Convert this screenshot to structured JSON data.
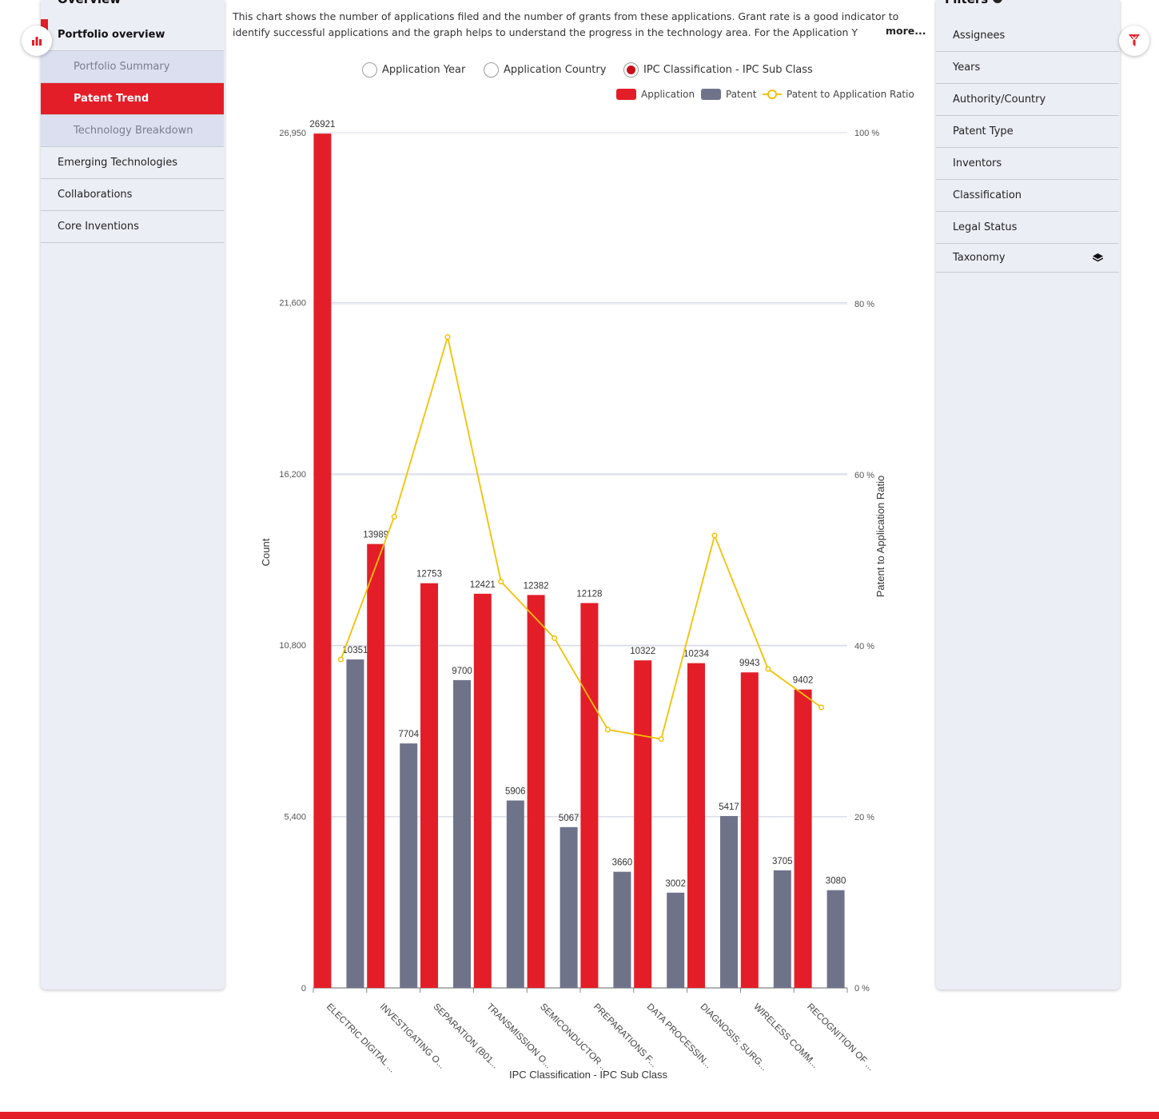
{
  "left_panel": {
    "title": "Overview",
    "items": [
      {
        "label": "Portfolio overview"
      },
      {
        "label": "Portfolio Summary"
      },
      {
        "label": "Patent Trend"
      },
      {
        "label": "Technology Breakdown"
      },
      {
        "label": "Emerging Technologies"
      },
      {
        "label": "Collaborations"
      },
      {
        "label": "Core Inventions"
      }
    ]
  },
  "right_panel": {
    "title": "Filters",
    "items": [
      {
        "label": "Assignees"
      },
      {
        "label": "Years"
      },
      {
        "label": "Authority/Country"
      },
      {
        "label": "Patent Type"
      },
      {
        "label": "Inventors"
      },
      {
        "label": "Classification"
      },
      {
        "label": "Legal Status"
      },
      {
        "label": "Taxonomy"
      }
    ]
  },
  "description": {
    "text": "This chart shows the number of applications filed and the number of grants from these applications. Grant rate is a good indicator to identify successful applications and the graph helps to understand the progress in the technology area. For the Application Y",
    "more": "more..."
  },
  "radios": {
    "options": [
      "Application Year",
      "Application Country",
      "IPC Classification - IPC Sub Class"
    ],
    "selected": "IPC Classification - IPC Sub Class"
  },
  "colors": {
    "application": "#e31e28",
    "patent": "#6f738a",
    "ratio": "#f5c000"
  },
  "chart_data": {
    "type": "bar",
    "legend": [
      "Application",
      "Patent",
      "Patent to Application Ratio"
    ],
    "xlabel": "IPC Classification - IPC Sub Class",
    "ylabel": "Count",
    "y2label": "Patent to Application Ratio",
    "ylim": [
      0,
      26950
    ],
    "y_ticks": [
      "0",
      "5,400",
      "10,800",
      "16,200",
      "21,600",
      "26,950"
    ],
    "y2lim": [
      0,
      100
    ],
    "y2_ticks": [
      "0 %",
      "20 %",
      "40 %",
      "60 %",
      "80 %",
      "100 %"
    ],
    "categories": [
      "ELECTRIC DIGITAL ...",
      "INVESTIGATING O...",
      "SEPARATION (B01...",
      "TRANSMISSION O...",
      "SEMICONDUCTOR ...",
      "PREPARATIONS F...",
      "DATA PROCESSIN...",
      "DIAGNOSIS; SURG...",
      "WIRELESS COMM...",
      "RECOGNITION OF ..."
    ],
    "series": [
      {
        "name": "Application",
        "values": [
          26921,
          13989,
          12753,
          12421,
          12382,
          12128,
          10322,
          10234,
          9943,
          9402
        ]
      },
      {
        "name": "Patent",
        "values": [
          10351,
          7704,
          9700,
          5906,
          5067,
          3660,
          3002,
          5417,
          3705,
          3080
        ]
      },
      {
        "name": "Patent to Application Ratio",
        "values": [
          38.4,
          55.1,
          76.1,
          47.5,
          40.9,
          30.2,
          29.1,
          52.9,
          37.3,
          32.8
        ]
      }
    ],
    "grid": true
  }
}
